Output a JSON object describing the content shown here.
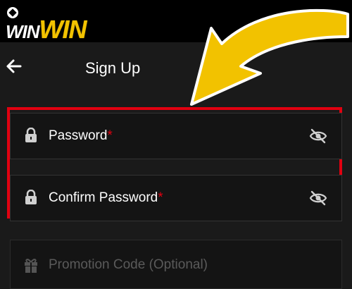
{
  "brand": {
    "logo_white": "WIN",
    "logo_gold": "WIN"
  },
  "header": {
    "title": "Sign Up"
  },
  "form": {
    "password_label": "Password",
    "password_required_mark": "*",
    "confirm_label": "Confirm Password",
    "confirm_required_mark": "*",
    "promo_placeholder": "Promotion Code (Optional)"
  },
  "icons": {
    "back": "arrow-left-icon",
    "lock": "lock-icon",
    "eye_off": "eye-off-icon",
    "gift": "gift-icon",
    "annotation_arrow": "curved-arrow-icon"
  },
  "colors": {
    "accent_gold": "#f2c200",
    "highlight_red": "#e10010",
    "background": "#1a1a1a"
  }
}
